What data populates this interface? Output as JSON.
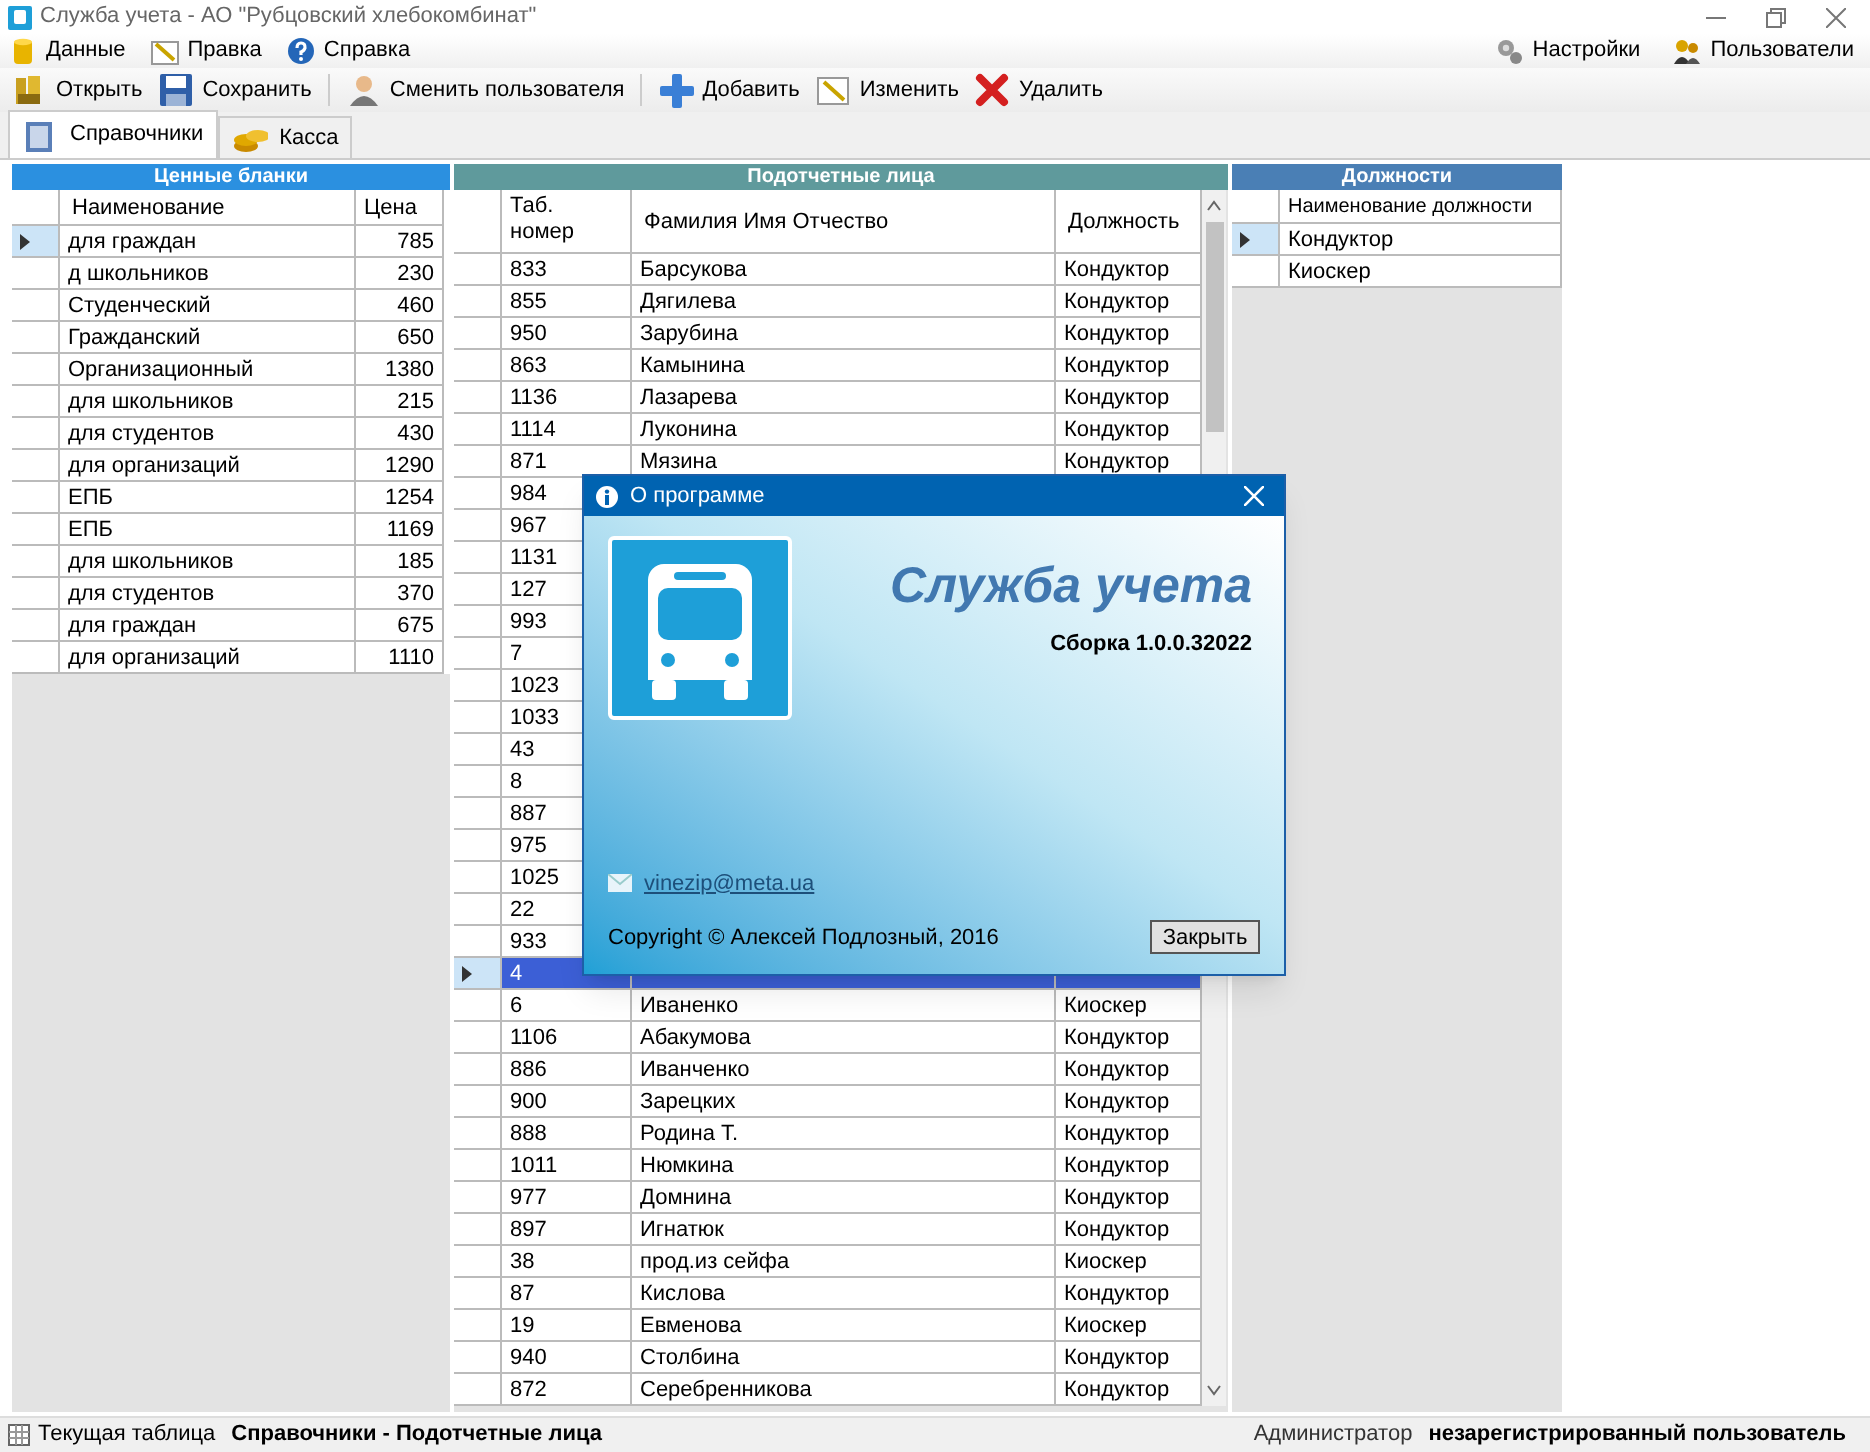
{
  "window": {
    "title": "Служба учета - АО \"Рубцовский хлебокомбинат\""
  },
  "menu": [
    {
      "label": "Данные",
      "kind": "data"
    },
    {
      "label": "Правка",
      "kind": "edit"
    },
    {
      "label": "Справка",
      "kind": "help"
    }
  ],
  "menu_right": [
    {
      "label": "Настройки",
      "kind": "settings"
    },
    {
      "label": "Пользователи",
      "kind": "users"
    }
  ],
  "toolbar": [
    {
      "label": "Открыть",
      "kind": "open"
    },
    {
      "label": "Сохранить",
      "kind": "save"
    },
    {
      "label": "Сменить пользователя",
      "kind": "user"
    },
    {
      "label": "Добавить",
      "kind": "add"
    },
    {
      "label": "Изменить",
      "kind": "edit"
    },
    {
      "label": "Удалить",
      "kind": "delete"
    }
  ],
  "tabs": [
    {
      "label": "Справочники",
      "selected": true,
      "kind": "book"
    },
    {
      "label": "Касса",
      "selected": false,
      "kind": "coins"
    }
  ],
  "blanks": {
    "title": "Ценные бланки",
    "columns": [
      "Наименование",
      "Цена"
    ],
    "rows": [
      {
        "name": "для граждан",
        "price": "785",
        "selected": true
      },
      {
        "name": "д школьников",
        "price": "230",
        "selected": false
      },
      {
        "name": "Студенческий",
        "price": "460",
        "selected": false
      },
      {
        "name": "Гражданский",
        "price": "650",
        "selected": false
      },
      {
        "name": "Организационный",
        "price": "1380",
        "selected": false
      },
      {
        "name": "для школьников",
        "price": "215",
        "selected": false
      },
      {
        "name": "для студентов",
        "price": "430",
        "selected": false
      },
      {
        "name": "для организаций",
        "price": "1290",
        "selected": false
      },
      {
        "name": "ЕПБ",
        "price": "1254",
        "selected": false
      },
      {
        "name": "ЕПБ",
        "price": "1169",
        "selected": false
      },
      {
        "name": "для школьников",
        "price": "185",
        "selected": false
      },
      {
        "name": "для студентов",
        "price": "370",
        "selected": false
      },
      {
        "name": "для граждан",
        "price": "675",
        "selected": false
      },
      {
        "name": "для организаций",
        "price": "1110",
        "selected": false
      }
    ]
  },
  "persons": {
    "title": "Подотчетные лица",
    "columns": [
      "Таб. номер",
      "Фамилия Имя Отчество",
      "Должность"
    ],
    "rows": [
      {
        "number": "833",
        "name": "Барсукова",
        "position": "Кондуктор",
        "selected": false
      },
      {
        "number": "855",
        "name": "Дягилева",
        "position": "Кондуктор",
        "selected": false
      },
      {
        "number": "950",
        "name": "Зарубина",
        "position": "Кондуктор",
        "selected": false
      },
      {
        "number": "863",
        "name": "Камынина",
        "position": "Кондуктор",
        "selected": false
      },
      {
        "number": "1136",
        "name": "Лазарева",
        "position": "Кондуктор",
        "selected": false
      },
      {
        "number": "1114",
        "name": "Луконина",
        "position": "Кондуктор",
        "selected": false
      },
      {
        "number": "871",
        "name": "Мязина",
        "position": "Кондуктор",
        "selected": false
      },
      {
        "number": "984",
        "selected": false
      },
      {
        "number": "967",
        "selected": false
      },
      {
        "number": "1131",
        "selected": false
      },
      {
        "number": "127",
        "selected": false
      },
      {
        "number": "993",
        "selected": false
      },
      {
        "number": "7",
        "selected": false
      },
      {
        "number": "1023",
        "selected": false
      },
      {
        "number": "1033",
        "selected": false
      },
      {
        "number": "43",
        "selected": false
      },
      {
        "number": "8",
        "selected": false
      },
      {
        "number": "887",
        "selected": false
      },
      {
        "number": "975",
        "selected": false
      },
      {
        "number": "1025",
        "selected": false
      },
      {
        "number": "22",
        "selected": false
      },
      {
        "number": "933",
        "selected": false
      },
      {
        "number": "4",
        "selected": true
      },
      {
        "number": "6",
        "name": "Иваненко",
        "position": "Киоскер",
        "selected": false
      },
      {
        "number": "1106",
        "name": "Абакумова",
        "position": "Кондуктор",
        "selected": false
      },
      {
        "number": "886",
        "name": "Иванченко",
        "position": "Кондуктор",
        "selected": false
      },
      {
        "number": "900",
        "name": "Зарецких",
        "position": "Кондуктор",
        "selected": false
      },
      {
        "number": "888",
        "name": "Родина Т.",
        "position": "Кондуктор",
        "selected": false
      },
      {
        "number": "1011",
        "name": "Нюмкина",
        "position": "Кондуктор",
        "selected": false
      },
      {
        "number": "977",
        "name": "Домнина",
        "position": "Кондуктор",
        "selected": false
      },
      {
        "number": "897",
        "name": "Игнатюк",
        "position": "Кондуктор",
        "selected": false
      },
      {
        "number": "38",
        "name": "прод.из сейфа",
        "position": "Киоскер",
        "selected": false
      },
      {
        "number": "87",
        "name": "Кислова",
        "position": "Кондуктор",
        "selected": false
      },
      {
        "number": "19",
        "name": "Евменова",
        "position": "Киоскер",
        "selected": false
      },
      {
        "number": "940",
        "name": "Столбина",
        "position": "Кондуктор",
        "selected": false
      },
      {
        "number": "872",
        "name": "Серебренникова",
        "position": "Кондуктор",
        "selected": false
      }
    ]
  },
  "positions": {
    "title": "Должности",
    "columns": [
      "Наименование должности"
    ],
    "rows": [
      {
        "name": "Кондуктор",
        "selected": true
      },
      {
        "name": "Киоскер",
        "selected": false
      }
    ]
  },
  "dialog": {
    "title": "О программе",
    "app_name": "Служба учета",
    "build": "Сборка 1.0.0.32022",
    "email": "vinezip@meta.ua",
    "copyright": "Copyright © Алексей Подлозный, 2016",
    "close_button": "Закрыть"
  },
  "status_bar": {
    "label": "Текущая таблица",
    "value": "Справочники - Подотчетные лица",
    "role": "Администратор",
    "user": "незарегистрированный пользователь"
  }
}
